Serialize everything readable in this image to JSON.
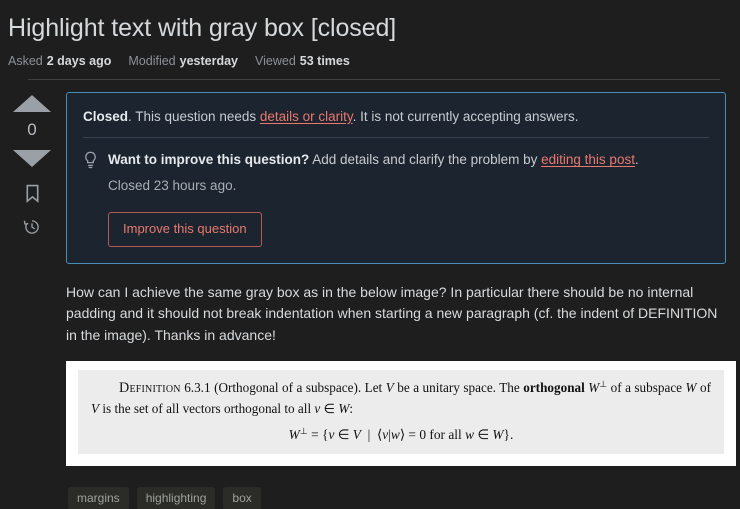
{
  "question": {
    "title": "Highlight text with gray box [closed]",
    "meta": [
      {
        "label": "Asked",
        "value": "2 days ago"
      },
      {
        "label": "Modified",
        "value": "yesterday"
      },
      {
        "label": "Viewed",
        "value": "53 times"
      }
    ]
  },
  "vote": {
    "up_icon": "triangle-up-icon",
    "count": "0",
    "down_icon": "triangle-down-icon",
    "bookmark_icon": "bookmark-icon",
    "history_icon": "history-clock-icon"
  },
  "notice": {
    "status_label": "Closed",
    "status_text_before": ". This question needs ",
    "status_link": "details or clarity",
    "status_text_after": ". It is not currently accepting answers.",
    "bulb_icon": "lightbulb-icon",
    "improve_heading": "Want to improve this question?",
    "improve_text_before": " Add details and clarify the problem by ",
    "improve_link": "editing this post",
    "improve_text_after": ".",
    "closed_ago": "Closed 23 hours ago.",
    "button_label": "Improve this question",
    "border_color": "#4c8db8",
    "background_color": "#1c2430",
    "link_color": "#e8796d"
  },
  "body": {
    "paragraph": "How can I achieve the same gray box as in the below image? In particular there should be no internal padding and it should not break indentation when starting a new paragraph (cf. the indent of DEFINITION in the image). Thanks in advance!"
  },
  "math_image": {
    "definition_label": "Definition",
    "number": "6.3.1",
    "title": "(Orthogonal of a subspace)",
    "line1": ". Let V be a unitary space. The orthogonal W⊥ of a subspace W of V is the set of all vectors orthogonal to all v ∈ W:",
    "equation": "W⊥ = {v ∈ V | ⟨v|w⟩ = 0 for all w ∈ W}.",
    "inner_bg": "#ececec",
    "outer_bg": "#ffffff"
  },
  "tags": [
    "margins",
    "highlighting",
    "box"
  ]
}
